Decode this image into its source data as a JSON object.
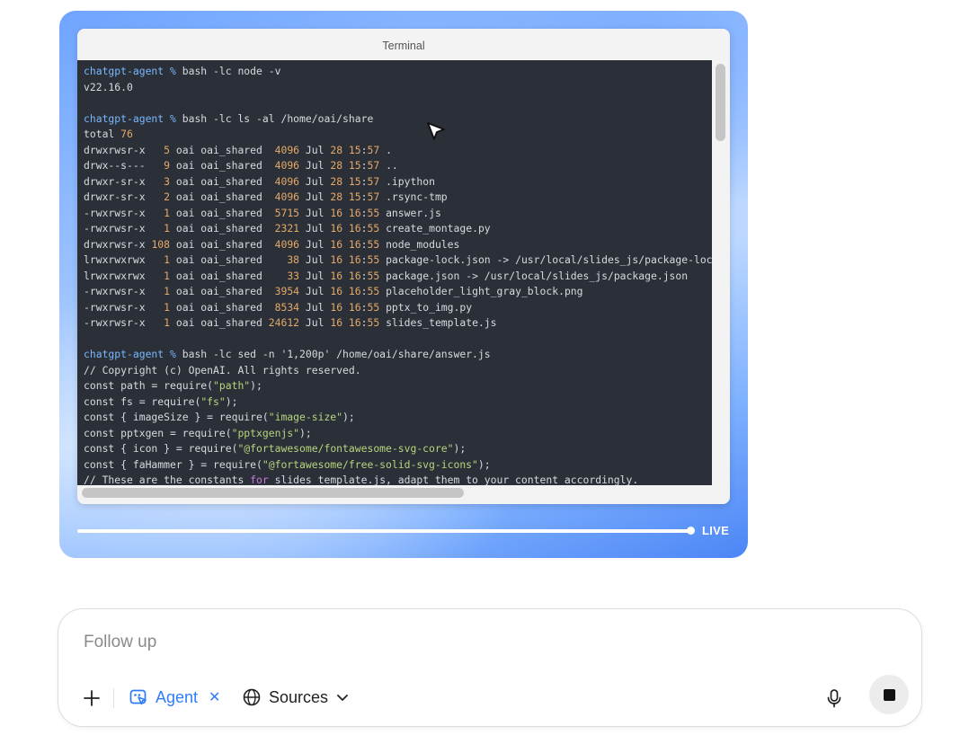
{
  "terminal": {
    "title": "Terminal",
    "lines": [
      [
        {
          "t": "chatgpt-agent % ",
          "c": "prompt"
        },
        {
          "t": "bash -lc node -v"
        }
      ],
      [
        {
          "t": "v22.16.0"
        }
      ],
      [],
      [
        {
          "t": "chatgpt-agent % ",
          "c": "prompt"
        },
        {
          "t": "bash -lc ls -al /home/oai/share"
        }
      ],
      [
        {
          "t": "total "
        },
        {
          "t": "76",
          "c": "num"
        }
      ],
      [
        {
          "t": "drwxrwsr-x   "
        },
        {
          "t": "5",
          "c": "num"
        },
        {
          "t": " oai oai_shared  "
        },
        {
          "t": "4096",
          "c": "num"
        },
        {
          "t": " Jul "
        },
        {
          "t": "28",
          "c": "num"
        },
        {
          "t": " "
        },
        {
          "t": "15",
          "c": "num"
        },
        {
          "t": ":"
        },
        {
          "t": "57",
          "c": "num"
        },
        {
          "t": " ."
        }
      ],
      [
        {
          "t": "drwx--s---   "
        },
        {
          "t": "9",
          "c": "num"
        },
        {
          "t": " oai oai_shared  "
        },
        {
          "t": "4096",
          "c": "num"
        },
        {
          "t": " Jul "
        },
        {
          "t": "28",
          "c": "num"
        },
        {
          "t": " "
        },
        {
          "t": "15",
          "c": "num"
        },
        {
          "t": ":"
        },
        {
          "t": "57",
          "c": "num"
        },
        {
          "t": " .."
        }
      ],
      [
        {
          "t": "drwxr-sr-x   "
        },
        {
          "t": "3",
          "c": "num"
        },
        {
          "t": " oai oai_shared  "
        },
        {
          "t": "4096",
          "c": "num"
        },
        {
          "t": " Jul "
        },
        {
          "t": "28",
          "c": "num"
        },
        {
          "t": " "
        },
        {
          "t": "15",
          "c": "num"
        },
        {
          "t": ":"
        },
        {
          "t": "57",
          "c": "num"
        },
        {
          "t": " .ipython"
        }
      ],
      [
        {
          "t": "drwxr-sr-x   "
        },
        {
          "t": "2",
          "c": "num"
        },
        {
          "t": " oai oai_shared  "
        },
        {
          "t": "4096",
          "c": "num"
        },
        {
          "t": " Jul "
        },
        {
          "t": "28",
          "c": "num"
        },
        {
          "t": " "
        },
        {
          "t": "15",
          "c": "num"
        },
        {
          "t": ":"
        },
        {
          "t": "57",
          "c": "num"
        },
        {
          "t": " .rsync-tmp"
        }
      ],
      [
        {
          "t": "-rwxrwsr-x   "
        },
        {
          "t": "1",
          "c": "num"
        },
        {
          "t": " oai oai_shared  "
        },
        {
          "t": "5715",
          "c": "num"
        },
        {
          "t": " Jul "
        },
        {
          "t": "16",
          "c": "num"
        },
        {
          "t": " "
        },
        {
          "t": "16",
          "c": "num"
        },
        {
          "t": ":"
        },
        {
          "t": "55",
          "c": "num"
        },
        {
          "t": " answer.js"
        }
      ],
      [
        {
          "t": "-rwxrwsr-x   "
        },
        {
          "t": "1",
          "c": "num"
        },
        {
          "t": " oai oai_shared  "
        },
        {
          "t": "2321",
          "c": "num"
        },
        {
          "t": " Jul "
        },
        {
          "t": "16",
          "c": "num"
        },
        {
          "t": " "
        },
        {
          "t": "16",
          "c": "num"
        },
        {
          "t": ":"
        },
        {
          "t": "55",
          "c": "num"
        },
        {
          "t": " create_montage.py"
        }
      ],
      [
        {
          "t": "drwxrwsr-x "
        },
        {
          "t": "108",
          "c": "num"
        },
        {
          "t": " oai oai_shared  "
        },
        {
          "t": "4096",
          "c": "num"
        },
        {
          "t": " Jul "
        },
        {
          "t": "16",
          "c": "num"
        },
        {
          "t": " "
        },
        {
          "t": "16",
          "c": "num"
        },
        {
          "t": ":"
        },
        {
          "t": "55",
          "c": "num"
        },
        {
          "t": " node_modules"
        }
      ],
      [
        {
          "t": "lrwxrwxrwx   "
        },
        {
          "t": "1",
          "c": "num"
        },
        {
          "t": " oai oai_shared    "
        },
        {
          "t": "38",
          "c": "num"
        },
        {
          "t": " Jul "
        },
        {
          "t": "16",
          "c": "num"
        },
        {
          "t": " "
        },
        {
          "t": "16",
          "c": "num"
        },
        {
          "t": ":"
        },
        {
          "t": "55",
          "c": "num"
        },
        {
          "t": " package-lock.json -> /usr/local/slides_js/package-lock.json"
        }
      ],
      [
        {
          "t": "lrwxrwxrwx   "
        },
        {
          "t": "1",
          "c": "num"
        },
        {
          "t": " oai oai_shared    "
        },
        {
          "t": "33",
          "c": "num"
        },
        {
          "t": " Jul "
        },
        {
          "t": "16",
          "c": "num"
        },
        {
          "t": " "
        },
        {
          "t": "16",
          "c": "num"
        },
        {
          "t": ":"
        },
        {
          "t": "55",
          "c": "num"
        },
        {
          "t": " package.json -> /usr/local/slides_js/package.json"
        }
      ],
      [
        {
          "t": "-rwxrwsr-x   "
        },
        {
          "t": "1",
          "c": "num"
        },
        {
          "t": " oai oai_shared  "
        },
        {
          "t": "3954",
          "c": "num"
        },
        {
          "t": " Jul "
        },
        {
          "t": "16",
          "c": "num"
        },
        {
          "t": " "
        },
        {
          "t": "16",
          "c": "num"
        },
        {
          "t": ":"
        },
        {
          "t": "55",
          "c": "num"
        },
        {
          "t": " placeholder_light_gray_block.png"
        }
      ],
      [
        {
          "t": "-rwxrwsr-x   "
        },
        {
          "t": "1",
          "c": "num"
        },
        {
          "t": " oai oai_shared  "
        },
        {
          "t": "8534",
          "c": "num"
        },
        {
          "t": " Jul "
        },
        {
          "t": "16",
          "c": "num"
        },
        {
          "t": " "
        },
        {
          "t": "16",
          "c": "num"
        },
        {
          "t": ":"
        },
        {
          "t": "55",
          "c": "num"
        },
        {
          "t": " pptx_to_img.py"
        }
      ],
      [
        {
          "t": "-rwxrwsr-x   "
        },
        {
          "t": "1",
          "c": "num"
        },
        {
          "t": " oai oai_shared "
        },
        {
          "t": "24612",
          "c": "num"
        },
        {
          "t": " Jul "
        },
        {
          "t": "16",
          "c": "num"
        },
        {
          "t": " "
        },
        {
          "t": "16",
          "c": "num"
        },
        {
          "t": ":"
        },
        {
          "t": "55",
          "c": "num"
        },
        {
          "t": " slides_template.js"
        }
      ],
      [],
      [
        {
          "t": "chatgpt-agent % ",
          "c": "prompt"
        },
        {
          "t": "bash -lc sed -n '1,200p' /home/oai/share/answer.js"
        }
      ],
      [
        {
          "t": "// Copyright (c) OpenAI. All rights reserved."
        }
      ],
      [
        {
          "t": "const path = require("
        },
        {
          "t": "\"path\"",
          "c": "str"
        },
        {
          "t": ");"
        }
      ],
      [
        {
          "t": "const fs = require("
        },
        {
          "t": "\"fs\"",
          "c": "str"
        },
        {
          "t": ");"
        }
      ],
      [
        {
          "t": "const { imageSize } = require("
        },
        {
          "t": "\"image-size\"",
          "c": "str"
        },
        {
          "t": ");"
        }
      ],
      [
        {
          "t": "const pptxgen = require("
        },
        {
          "t": "\"pptxgenjs\"",
          "c": "str"
        },
        {
          "t": ");"
        }
      ],
      [
        {
          "t": "const { icon } = require("
        },
        {
          "t": "\"@fortawesome/fontawesome-svg-core\"",
          "c": "str"
        },
        {
          "t": ");"
        }
      ],
      [
        {
          "t": "const { faHammer } = require("
        },
        {
          "t": "\"@fortawesome/free-solid-svg-icons\"",
          "c": "str"
        },
        {
          "t": ");"
        }
      ],
      [
        {
          "t": "// These are the constants "
        },
        {
          "t": "for",
          "c": "kw"
        },
        {
          "t": " slides_template.js, adapt them to your content accordingly."
        }
      ]
    ]
  },
  "viewer": {
    "live_label": "LIVE",
    "progress": 1.0
  },
  "composer": {
    "placeholder": "Follow up",
    "agent_label": "Agent",
    "sources_label": "Sources",
    "accent_color": "#2f7cf6"
  },
  "icons": {
    "plus": "plus-icon",
    "agent": "agent-icon",
    "close": "close-icon",
    "globe": "globe-icon",
    "chevron": "chevron-down-icon",
    "mic": "microphone-icon",
    "stop": "stop-icon",
    "cursor": "mouse-cursor-icon"
  }
}
